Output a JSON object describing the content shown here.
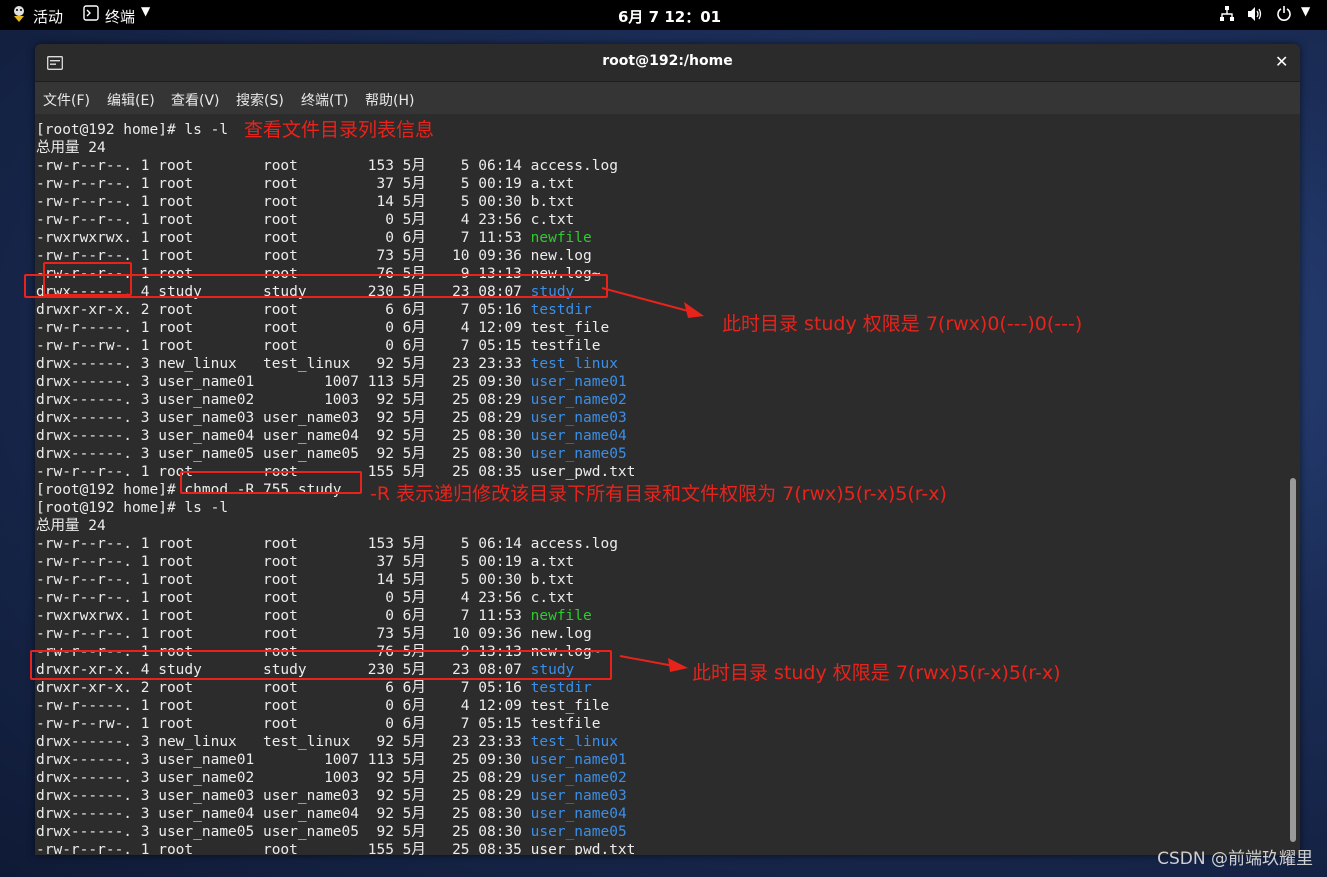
{
  "topbar": {
    "activities": "活动",
    "app_menu": "终端",
    "clock": "6月 7  12：01"
  },
  "window": {
    "title": "root@192:/home"
  },
  "menu": [
    "文件(F)",
    "编辑(E)",
    "查看(V)",
    "搜索(S)",
    "终端(T)",
    "帮助(H)"
  ],
  "terminal": {
    "lines": [
      {
        "t": "[root@192 home]# ls -l"
      },
      {
        "t": "总用量 24"
      },
      {
        "t": "-rw-r--r--. 1 root        root        153 5月    5 06:14 access.log"
      },
      {
        "t": "-rw-r--r--. 1 root        root         37 5月    5 00:19 a.txt"
      },
      {
        "t": "-rw-r--r--. 1 root        root         14 5月    5 00:30 b.txt"
      },
      {
        "t": "-rw-r--r--. 1 root        root          0 5月    4 23:56 c.txt"
      },
      {
        "t": "-rwxrwxrwx. 1 root        root          0 6月    7 11:53 ",
        "n": "newfile",
        "c": "green"
      },
      {
        "t": "-rw-r--r--. 1 root        root         73 5月   10 09:36 new.log"
      },
      {
        "t": "-rw-r--r--. 1 root        root         76 5月    9 13:13 new.log~"
      },
      {
        "t": "drwx------. 4 study       study       230 5月   23 08:07 ",
        "n": "study",
        "c": "blue"
      },
      {
        "t": "drwxr-xr-x. 2 root        root          6 6月    7 05:16 ",
        "n": "testdir",
        "c": "blue"
      },
      {
        "t": "-rw-r-----. 1 root        root          0 6月    4 12:09 test_file"
      },
      {
        "t": "-rw-r--rw-. 1 root        root          0 6月    7 05:15 testfile"
      },
      {
        "t": "drwx------. 3 new_linux   test_linux   92 5月   23 23:33 ",
        "n": "test_linux",
        "c": "blue"
      },
      {
        "t": "drwx------. 3 user_name01        1007 113 5月   25 09:30 ",
        "n": "user_name01",
        "c": "blue"
      },
      {
        "t": "drwx------. 3 user_name02        1003  92 5月   25 08:29 ",
        "n": "user_name02",
        "c": "blue"
      },
      {
        "t": "drwx------. 3 user_name03 user_name03  92 5月   25 08:29 ",
        "n": "user_name03",
        "c": "blue"
      },
      {
        "t": "drwx------. 3 user_name04 user_name04  92 5月   25 08:30 ",
        "n": "user_name04",
        "c": "blue"
      },
      {
        "t": "drwx------. 3 user_name05 user_name05  92 5月   25 08:30 ",
        "n": "user_name05",
        "c": "blue"
      },
      {
        "t": "-rw-r--r--. 1 root        root        155 5月   25 08:35 user_pwd.txt"
      },
      {
        "t": "[root@192 home]# chmod -R 755 study"
      },
      {
        "t": "[root@192 home]# ls -l"
      },
      {
        "t": "总用量 24"
      },
      {
        "t": "-rw-r--r--. 1 root        root        153 5月    5 06:14 access.log"
      },
      {
        "t": "-rw-r--r--. 1 root        root         37 5月    5 00:19 a.txt"
      },
      {
        "t": "-rw-r--r--. 1 root        root         14 5月    5 00:30 b.txt"
      },
      {
        "t": "-rw-r--r--. 1 root        root          0 5月    4 23:56 c.txt"
      },
      {
        "t": "-rwxrwxrwx. 1 root        root          0 6月    7 11:53 ",
        "n": "newfile",
        "c": "green"
      },
      {
        "t": "-rw-r--r--. 1 root        root         73 5月   10 09:36 new.log"
      },
      {
        "t": "-rw-r--r--. 1 root        root         76 5月    9 13:13 new.log~"
      },
      {
        "t": "drwxr-xr-x. 4 study       study       230 5月   23 08:07 ",
        "n": "study",
        "c": "blue"
      },
      {
        "t": "drwxr-xr-x. 2 root        root          6 6月    7 05:16 ",
        "n": "testdir",
        "c": "blue"
      },
      {
        "t": "-rw-r-----. 1 root        root          0 6月    4 12:09 test_file"
      },
      {
        "t": "-rw-r--rw-. 1 root        root          0 6月    7 05:15 testfile"
      },
      {
        "t": "drwx------. 3 new_linux   test_linux   92 5月   23 23:33 ",
        "n": "test_linux",
        "c": "blue"
      },
      {
        "t": "drwx------. 3 user_name01        1007 113 5月   25 09:30 ",
        "n": "user_name01",
        "c": "blue"
      },
      {
        "t": "drwx------. 3 user_name02        1003  92 5月   25 08:29 ",
        "n": "user_name02",
        "c": "blue"
      },
      {
        "t": "drwx------. 3 user_name03 user_name03  92 5月   25 08:29 ",
        "n": "user_name03",
        "c": "blue"
      },
      {
        "t": "drwx------. 3 user_name04 user_name04  92 5月   25 08:30 ",
        "n": "user_name04",
        "c": "blue"
      },
      {
        "t": "drwx------. 3 user_name05 user_name05  92 5月   25 08:30 ",
        "n": "user_name05",
        "c": "blue"
      },
      {
        "t": "-rw-r--r--. 1 root        root        155 5月   25 08:35 user_pwd.txt"
      }
    ]
  },
  "annotations": {
    "a1": "查看文件目录列表信息",
    "a2": "此时目录 study 权限是 7(rwx)0(---)0(---)",
    "a3": "-R 表示递归修改该目录下所有目录和文件权限为 7(rwx)5(r-x)5(r-x)",
    "a4": "此时目录 study 权限是 7(rwx)5(r-x)5(r-x)"
  },
  "watermark": "CSDN @前端玖耀里",
  "colors": {
    "annotation": "#e8231c",
    "dir_blue": "#3b8fe8",
    "exec_green": "#2ecc2e"
  },
  "icons": [
    "activities-icon",
    "terminal-app-icon",
    "network-icon",
    "volume-icon",
    "power-icon",
    "terminal-window-icon",
    "close-icon"
  ]
}
